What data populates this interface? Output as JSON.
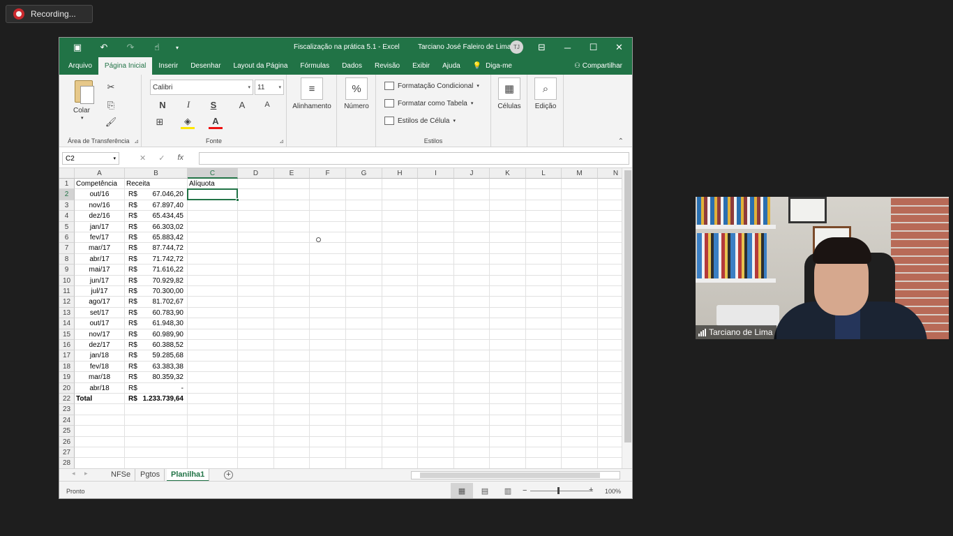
{
  "recording": {
    "label": "Recording..."
  },
  "window": {
    "title": "Fiscalização na prática 5.1  -  Excel",
    "user": "Tarciano José Faleiro de Lima",
    "avatar_initials": "TJ"
  },
  "menu": {
    "tabs": [
      "Arquivo",
      "Página Inicial",
      "Inserir",
      "Desenhar",
      "Layout da Página",
      "Fórmulas",
      "Dados",
      "Revisão",
      "Exibir",
      "Ajuda",
      "Diga-me"
    ],
    "active": "Página Inicial",
    "share": "Compartilhar"
  },
  "ribbon": {
    "clipboard": {
      "paste": "Colar",
      "group": "Área de Transferência"
    },
    "font": {
      "name": "Calibri",
      "size": "11",
      "bold": "N",
      "italic": "I",
      "underline": "S",
      "grow": "A",
      "shrink": "A",
      "color_letter": "A",
      "group": "Fonte"
    },
    "alignment": {
      "label": "Alinhamento"
    },
    "number": {
      "label": "Número",
      "symbol": "%"
    },
    "styles": {
      "conditional": "Formatação Condicional",
      "table": "Formatar como Tabela",
      "cell": "Estilos de Célula",
      "group": "Estilos"
    },
    "cells": {
      "label": "Células"
    },
    "editing": {
      "label": "Edição"
    }
  },
  "formula_bar": {
    "name_box": "C2",
    "fx": "fx",
    "value": ""
  },
  "columns": [
    "A",
    "B",
    "C",
    "D",
    "E",
    "F",
    "G",
    "H",
    "I",
    "J",
    "K",
    "L",
    "M",
    "N"
  ],
  "selected_column": "C",
  "rows": [
    {
      "n": "1",
      "a": "Competência",
      "b_cur": "",
      "b": "Receita",
      "c": "Alíquota",
      "bold": false
    },
    {
      "n": "2",
      "a": "out/16",
      "b_cur": "R$",
      "b": "67.046,20",
      "c": "",
      "bold": false
    },
    {
      "n": "3",
      "a": "nov/16",
      "b_cur": "R$",
      "b": "67.897,40",
      "c": "",
      "bold": false
    },
    {
      "n": "4",
      "a": "dez/16",
      "b_cur": "R$",
      "b": "65.434,45",
      "c": "",
      "bold": false
    },
    {
      "n": "5",
      "a": "jan/17",
      "b_cur": "R$",
      "b": "66.303,02",
      "c": "",
      "bold": false
    },
    {
      "n": "6",
      "a": "fev/17",
      "b_cur": "R$",
      "b": "65.883,42",
      "c": "",
      "bold": false
    },
    {
      "n": "7",
      "a": "mar/17",
      "b_cur": "R$",
      "b": "87.744,72",
      "c": "",
      "bold": false
    },
    {
      "n": "8",
      "a": "abr/17",
      "b_cur": "R$",
      "b": "71.742,72",
      "c": "",
      "bold": false
    },
    {
      "n": "9",
      "a": "mai/17",
      "b_cur": "R$",
      "b": "71.616,22",
      "c": "",
      "bold": false
    },
    {
      "n": "10",
      "a": "jun/17",
      "b_cur": "R$",
      "b": "70.929,82",
      "c": "",
      "bold": false
    },
    {
      "n": "11",
      "a": "jul/17",
      "b_cur": "R$",
      "b": "70.300,00",
      "c": "",
      "bold": false
    },
    {
      "n": "12",
      "a": "ago/17",
      "b_cur": "R$",
      "b": "81.702,67",
      "c": "",
      "bold": false
    },
    {
      "n": "13",
      "a": "set/17",
      "b_cur": "R$",
      "b": "60.783,90",
      "c": "",
      "bold": false
    },
    {
      "n": "14",
      "a": "out/17",
      "b_cur": "R$",
      "b": "61.948,30",
      "c": "",
      "bold": false
    },
    {
      "n": "15",
      "a": "nov/17",
      "b_cur": "R$",
      "b": "60.989,90",
      "c": "",
      "bold": false
    },
    {
      "n": "16",
      "a": "dez/17",
      "b_cur": "R$",
      "b": "60.388,52",
      "c": "",
      "bold": false
    },
    {
      "n": "17",
      "a": "jan/18",
      "b_cur": "R$",
      "b": "59.285,68",
      "c": "",
      "bold": false
    },
    {
      "n": "18",
      "a": "fev/18",
      "b_cur": "R$",
      "b": "63.383,38",
      "c": "",
      "bold": false
    },
    {
      "n": "19",
      "a": "mar/18",
      "b_cur": "R$",
      "b": "80.359,32",
      "c": "",
      "bold": false
    },
    {
      "n": "20",
      "a": "abr/18",
      "b_cur": "R$",
      "b": "-",
      "c": "",
      "bold": false
    },
    {
      "n": "22",
      "a": "Total",
      "b_cur": "R$",
      "b": "1.233.739,64",
      "c": "",
      "bold": true
    },
    {
      "n": "23",
      "a": "",
      "b_cur": "",
      "b": "",
      "c": "",
      "bold": false
    },
    {
      "n": "24",
      "a": "",
      "b_cur": "",
      "b": "",
      "c": "",
      "bold": false
    },
    {
      "n": "25",
      "a": "",
      "b_cur": "",
      "b": "",
      "c": "",
      "bold": false
    },
    {
      "n": "26",
      "a": "",
      "b_cur": "",
      "b": "",
      "c": "",
      "bold": false
    },
    {
      "n": "27",
      "a": "",
      "b_cur": "",
      "b": "",
      "c": "",
      "bold": false
    },
    {
      "n": "28",
      "a": "",
      "b_cur": "",
      "b": "",
      "c": "",
      "bold": false
    }
  ],
  "sheets": {
    "tabs": [
      "NFSe",
      "Pgtos",
      "Planilha1"
    ],
    "active": "Planilha1"
  },
  "status": {
    "text": "Pronto",
    "zoom": "100%"
  },
  "video": {
    "participant": "Tarciano de Lima"
  },
  "colors": {
    "excel_green": "#217346",
    "recording_red": "#c9282d"
  }
}
